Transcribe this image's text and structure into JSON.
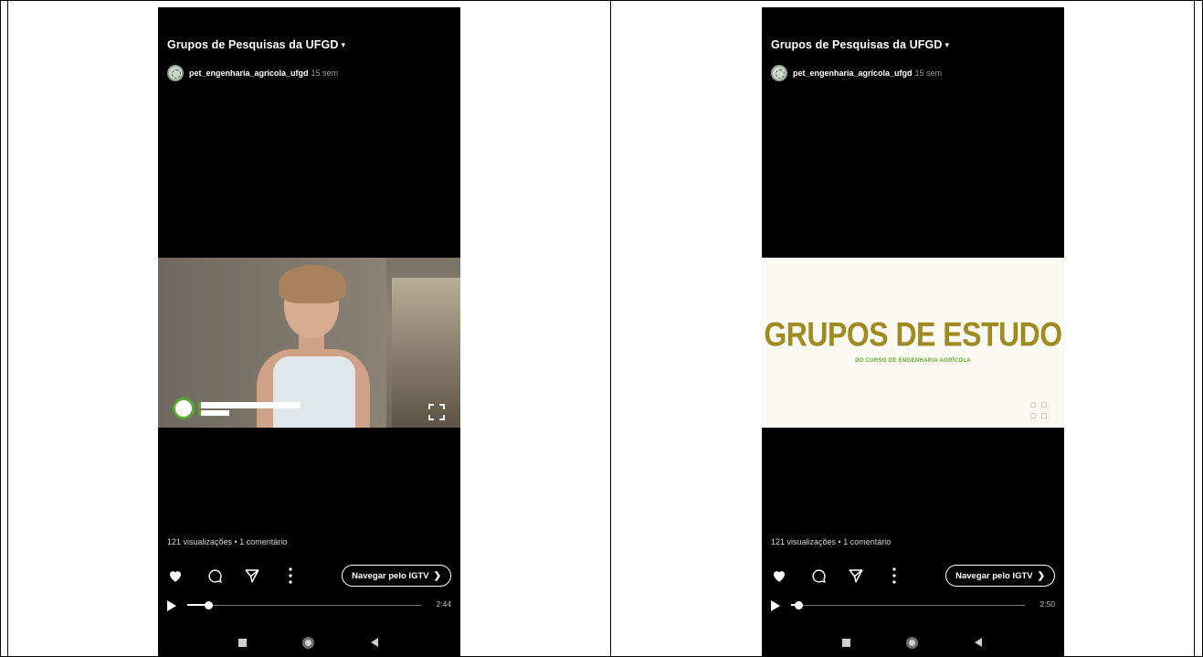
{
  "panels": [
    {
      "channel_title": "Grupos de Pesquisas da UFGD",
      "account_name": "pet_engenharia_agricola_ufgd",
      "post_age": "15 sem",
      "video_kind": "person",
      "lower_third_title": "",
      "stats": "121 visualizações • 1 comentário",
      "igtv_label": "Navegar pelo IGTV",
      "progress_fraction": 0.09,
      "duration": "2:44"
    },
    {
      "channel_title": "Grupos de Pesquisas da UFGD",
      "account_name": "pet_engenharia_agricola_ufgd",
      "post_age": "15 sem",
      "video_kind": "slide",
      "slide_title": "GRUPOS DE ESTUDO",
      "slide_subtitle": "DO CURSO DE ENGENHARIA AGRÍCOLA",
      "stats": "121 visualizações • 1 comentário",
      "igtv_label": "Navegar pelo IGTV",
      "progress_fraction": 0.03,
      "duration": "2:50"
    }
  ],
  "icons": {
    "chevron": "caret-down-icon",
    "like": "heart-icon",
    "comment": "comment-icon",
    "share": "paper-plane-icon",
    "more": "vertical-dots-icon",
    "play": "play-icon",
    "fullscreen": "fullscreen-icon",
    "nav_recent": "square-icon",
    "nav_home": "circle-icon",
    "nav_back": "triangle-back-icon"
  },
  "colors": {
    "background": "#000000",
    "slide_title": "#a08a22",
    "slide_subtitle": "#5fa82f",
    "accent_green": "#5ca834"
  }
}
